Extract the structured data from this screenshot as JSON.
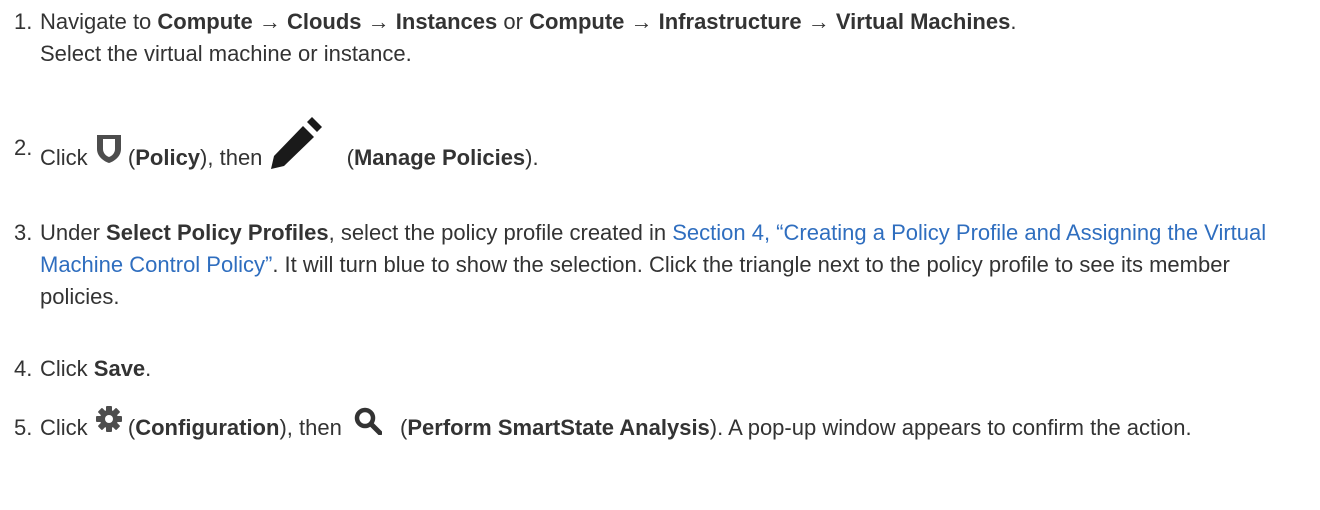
{
  "steps": [
    {
      "number": "1.",
      "parts": {
        "a": "Navigate to ",
        "b1": "Compute",
        "arrow1": " → ",
        "b2": "Clouds",
        "arrow2": " → ",
        "b3": "Instances",
        "or": " or ",
        "b4": "Compute",
        "arrow3": " → ",
        "b5": "Infrastructure",
        "arrow4": " → ",
        "b6": "Virtual Machines",
        "end": ".",
        "line2": "Select the virtual machine or instance."
      }
    },
    {
      "number": "2.",
      "parts": {
        "a": "Click ",
        "open1": " (",
        "b1": "Policy",
        "mid": "), then ",
        "open2": " (",
        "b2": "Manage Policies",
        "end": ")."
      },
      "icons": [
        "shield-icon",
        "pencil-icon"
      ]
    },
    {
      "number": "3.",
      "parts": {
        "a": "Under ",
        "b1": "Select Policy Profiles",
        "mid": ", select the policy profile created in ",
        "link": "Section 4, “Creating a Policy Profile and Assigning the Virtual Machine Control Policy”",
        "end": ". It will turn blue to show the selection. Click the triangle next to the policy profile to see its member policies."
      }
    },
    {
      "number": "4.",
      "parts": {
        "a": "Click ",
        "b1": "Save",
        "end": "."
      }
    },
    {
      "number": "5.",
      "parts": {
        "a": "Click ",
        "open1": " (",
        "b1": "Configuration",
        "mid": "), then ",
        "open2": " (",
        "b2": "Perform SmartState Analysis",
        "end": "). A pop-up window appears to confirm the action."
      },
      "icons": [
        "gear-icon",
        "magnifier-icon"
      ]
    }
  ],
  "colors": {
    "text": "#333333",
    "link": "#2f6ebf",
    "icon": "#4d4d4d"
  }
}
